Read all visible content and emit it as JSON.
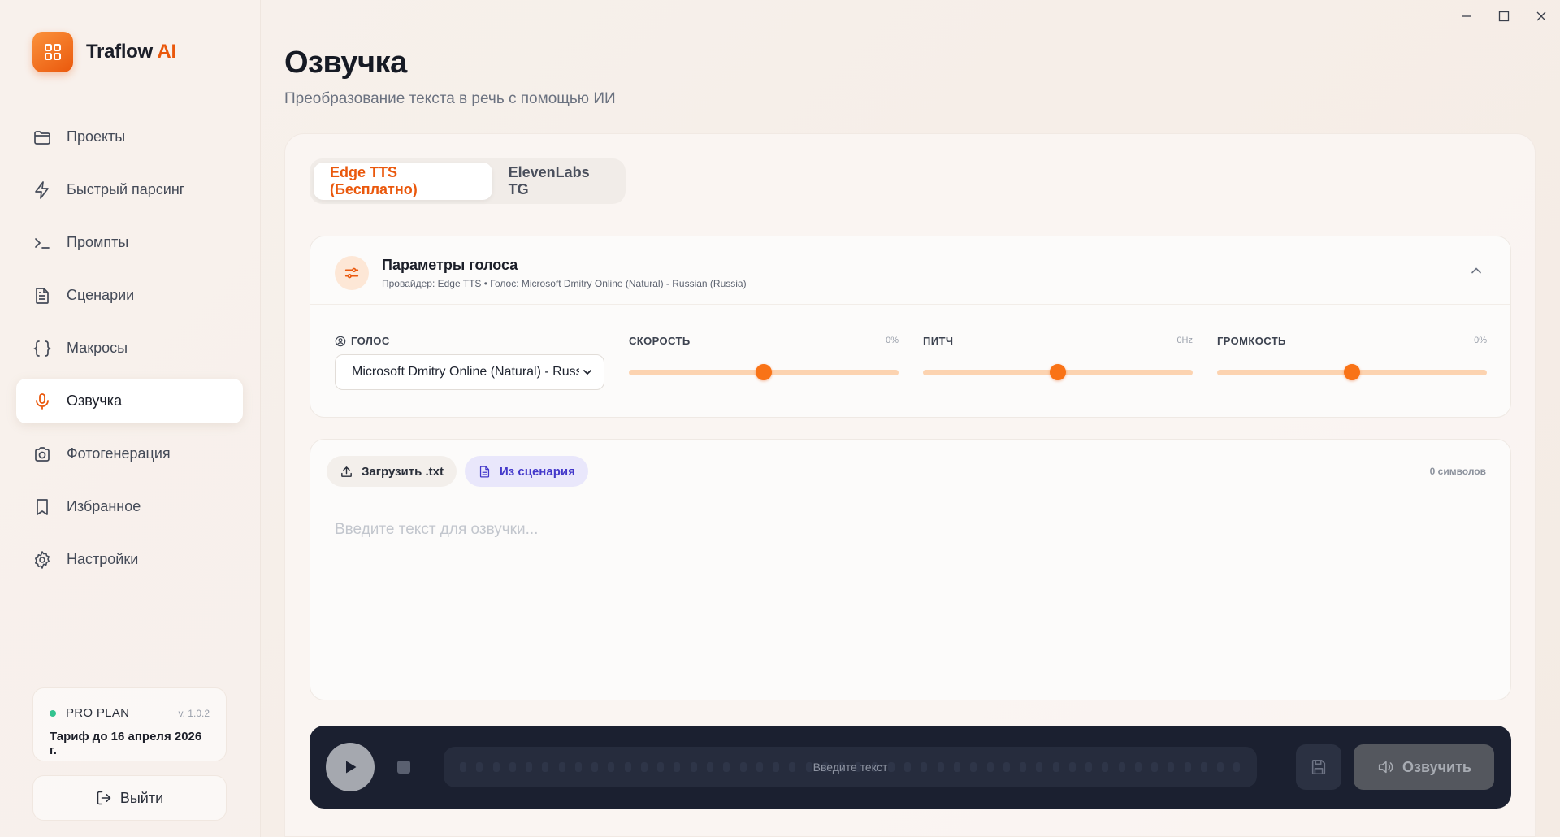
{
  "brand": {
    "name": "Traflow",
    "accent": "AI",
    "accent_color": "#ea580c"
  },
  "sidebar": {
    "items": [
      {
        "label": "Проекты",
        "icon": "folder-icon"
      },
      {
        "label": "Быстрый парсинг",
        "icon": "lightning-icon"
      },
      {
        "label": "Промпты",
        "icon": "terminal-icon"
      },
      {
        "label": "Сценарии",
        "icon": "document-icon"
      },
      {
        "label": "Макросы",
        "icon": "braces-icon"
      },
      {
        "label": "Озвучка",
        "icon": "microphone-icon",
        "active": true
      },
      {
        "label": "Фотогенерация",
        "icon": "camera-icon"
      },
      {
        "label": "Избранное",
        "icon": "bookmark-icon"
      },
      {
        "label": "Настройки",
        "icon": "gear-icon"
      }
    ],
    "plan": {
      "name": "PRO PLAN",
      "version": "v. 1.0.2",
      "until": "Тариф до 16 апреля 2026 г."
    },
    "logout_label": "Выйти"
  },
  "page": {
    "title": "Озвучка",
    "subtitle": "Преобразование текста в речь с помощью ИИ"
  },
  "tabs": [
    {
      "label": "Edge TTS (Бесплатно)",
      "active": true
    },
    {
      "label": "ElevenLabs TG",
      "active": false
    }
  ],
  "voice_params": {
    "title": "Параметры голоса",
    "subtitle": "Провайдер: Edge TTS • Голос: Microsoft Dmitry Online (Natural) - Russian (Russia)",
    "voice_label": "ГОЛОС",
    "voice_value": "Microsoft Dmitry Online (Natural) - Russian (Russia)",
    "speed": {
      "label": "СКОРОСТЬ",
      "value_text": "0%",
      "level": 0.5
    },
    "pitch": {
      "label": "ПИТЧ",
      "value_text": "0Hz",
      "level": 0.5
    },
    "volume": {
      "label": "ГРОМКОСТЬ",
      "value_text": "0%",
      "level": 0.5
    }
  },
  "editor": {
    "upload_label": "Загрузить .txt",
    "from_script_label": "Из сценария",
    "char_count": "0 символов",
    "placeholder": "Введите текст для озвучки...",
    "value": ""
  },
  "player": {
    "wave_text": "Введите текст",
    "voice_button_label": "Озвучить"
  }
}
